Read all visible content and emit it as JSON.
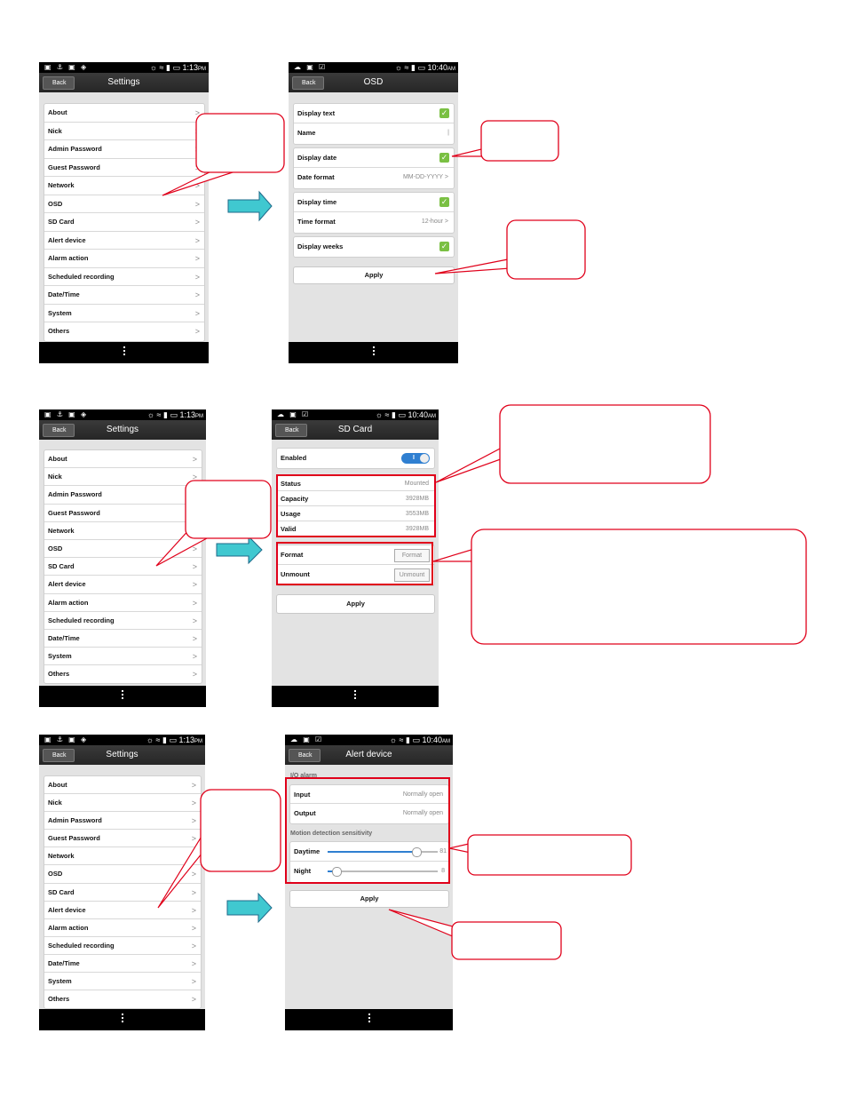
{
  "status": {
    "settings_time": "1:13",
    "settings_ampm": "PM",
    "detail_time": "10:40",
    "detail_ampm": "AM",
    "left_icons": "▣ ⚓ ▣ ◈",
    "detail_icons": "☁ ▣ ☑",
    "right_icons": "☼ ≈ ▮ ▭"
  },
  "common": {
    "back": "Back",
    "settings_title": "Settings",
    "settings_items": [
      "About",
      "Nick",
      "Admin Password",
      "Guest Password",
      "Network",
      "OSD",
      "SD Card",
      "Alert device",
      "Alarm action",
      "Scheduled recording",
      "Date/Time",
      "System",
      "Others"
    ],
    "chevron": ">",
    "apply": "Apply"
  },
  "osd": {
    "title": "OSD",
    "display_text": "Display text",
    "name": "Name",
    "display_date": "Display date",
    "date_format": "Date format",
    "date_format_value": "MM-DD-YYYY",
    "display_time": "Display time",
    "time_format": "Time format",
    "time_format_value": "12-hour",
    "display_weeks": "Display weeks"
  },
  "sd": {
    "title": "SD Card",
    "enabled": "Enabled",
    "toggle_mark": "I",
    "status": "Status",
    "status_value": "Mounted",
    "capacity": "Capacity",
    "capacity_value": "3928MB",
    "usage": "Usage",
    "usage_value": "3553MB",
    "valid": "Valid",
    "valid_value": "3928MB",
    "format": "Format",
    "format_btn": "Format",
    "unmount": "Unmount",
    "unmount_btn": "Unmount"
  },
  "alert": {
    "title": "Alert device",
    "io_alarm": "I/O alarm",
    "input": "Input",
    "input_value": "Normally open",
    "output": "Output",
    "output_value": "Normally open",
    "motion_label": "Motion detection sensitivity",
    "daytime": "Daytime",
    "daytime_value": "81",
    "night": "Night",
    "night_value": "8"
  },
  "colors": {
    "callout": "#e0001a",
    "arrow": "#40c8d0",
    "check": "#7ac043",
    "toggle": "#2f7fd1"
  }
}
